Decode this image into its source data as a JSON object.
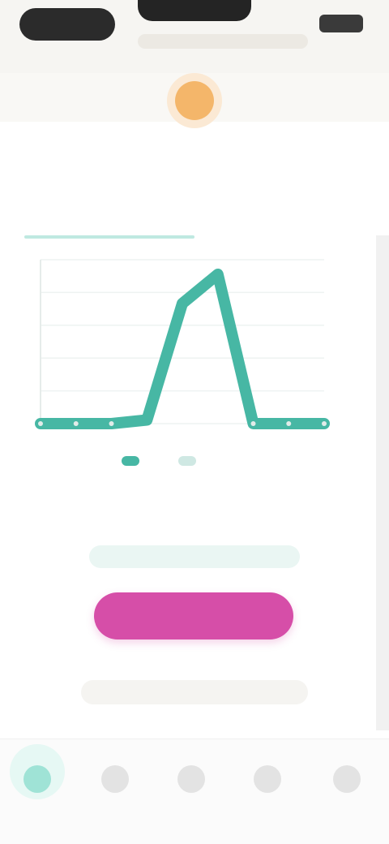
{
  "app": {
    "title": "",
    "accent_color": "#47b7a4",
    "cta_color": "#d64ea8",
    "logo_icon": "sun-logo"
  },
  "tabs": [
    {
      "label": "",
      "active": true
    },
    {
      "label": "",
      "active": false
    }
  ],
  "chart_data": {
    "type": "line",
    "title": "",
    "xlabel": "",
    "ylabel": "",
    "series": [
      {
        "values": [
          0,
          0,
          0,
          1,
          33,
          41,
          0,
          0,
          0
        ]
      }
    ],
    "ylim": [
      0,
      45
    ],
    "grid": true
  },
  "legend": [
    {
      "label": ""
    },
    {
      "label": ""
    }
  ],
  "summary": {
    "text": "",
    "subtext": ""
  },
  "cta": {
    "label": ""
  },
  "footnote": "",
  "bottom_nav": [
    {
      "label": "",
      "icon": "home-icon",
      "active": true
    },
    {
      "label": "",
      "icon": "chart-icon",
      "active": false
    },
    {
      "label": "",
      "icon": "calendar-icon",
      "active": false
    },
    {
      "label": "",
      "icon": "profile-icon",
      "active": false
    },
    {
      "label": "",
      "icon": "more-icon",
      "active": false
    }
  ]
}
